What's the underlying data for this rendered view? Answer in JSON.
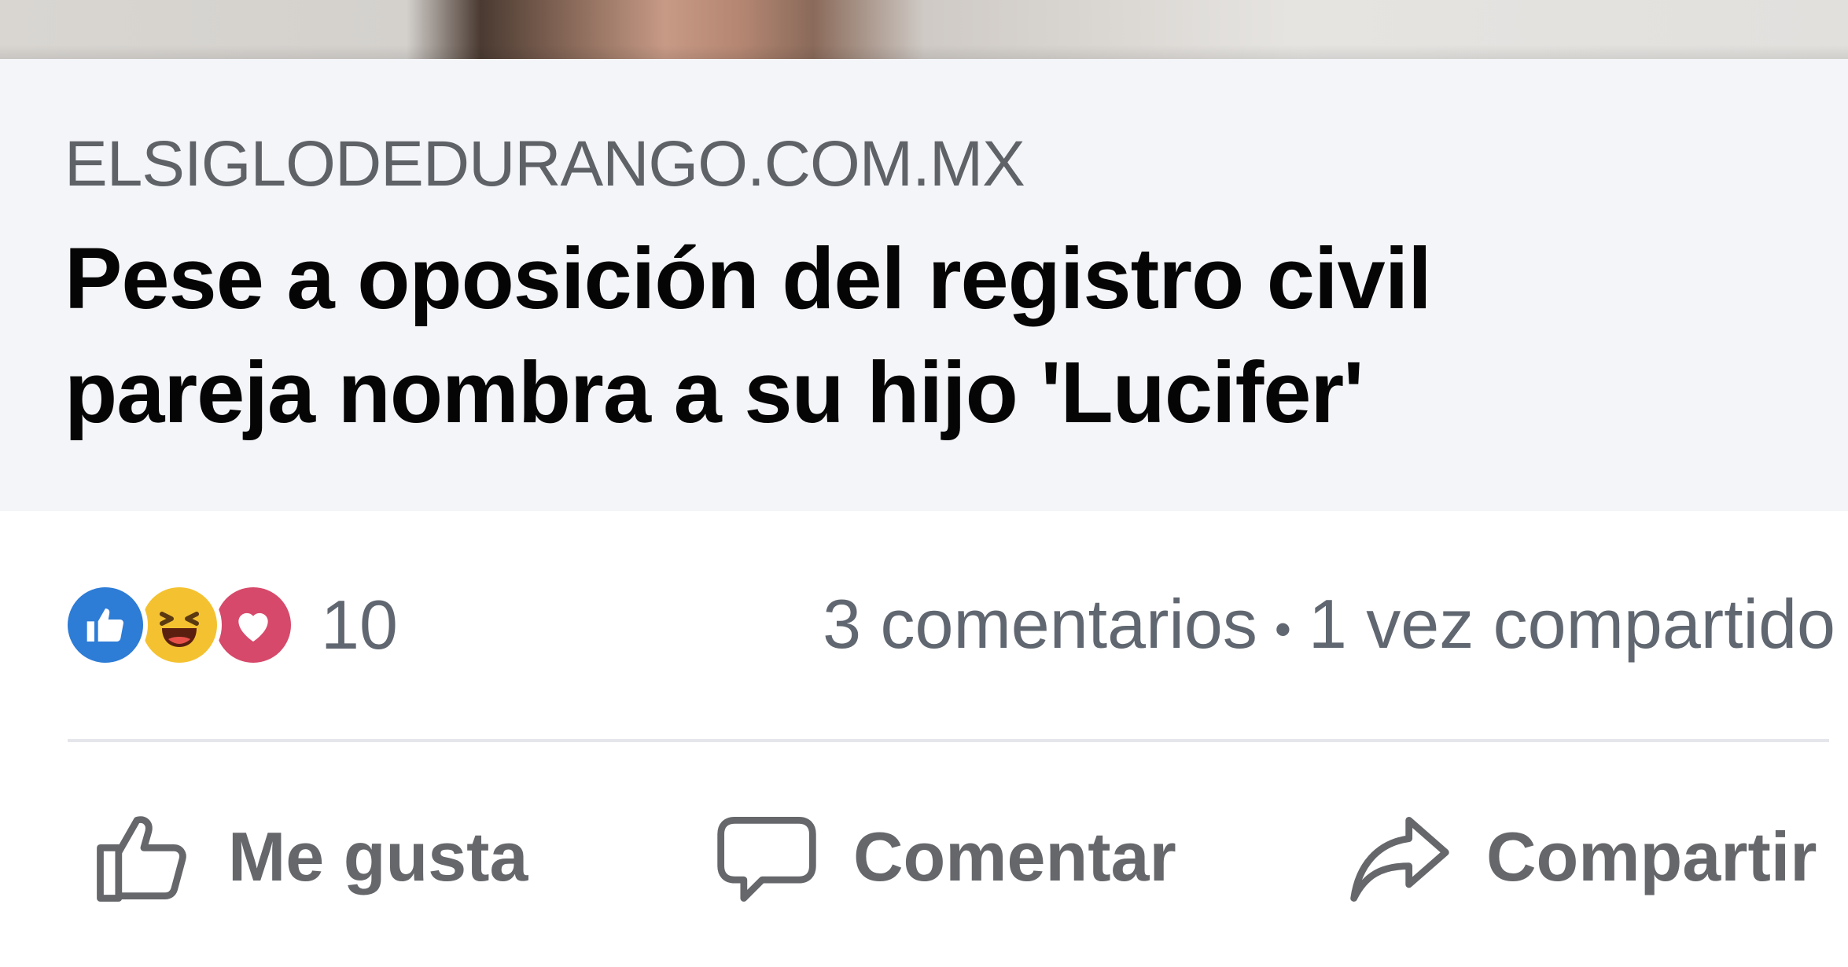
{
  "link_card": {
    "domain": "ELSIGLODEDURANGO.COM.MX",
    "headline_line1": "Pese a oposición del registro civil",
    "headline_line2": "pareja nombra a su hijo 'Lucifer'"
  },
  "stats": {
    "reactions": [
      "like-icon",
      "haha-icon",
      "love-icon"
    ],
    "reaction_count": "10",
    "comments": "3 comentarios",
    "separator": "•",
    "shares": "1 vez compartido"
  },
  "actions": {
    "like_label": "Me gusta",
    "comment_label": "Comentar",
    "share_label": "Compartir"
  },
  "colors": {
    "like": "#2d7cd6",
    "haha": "#f4c230",
    "love": "#d6496a",
    "muted_text": "#606770",
    "headline": "#050505",
    "card_bg": "#f4f5f8"
  }
}
